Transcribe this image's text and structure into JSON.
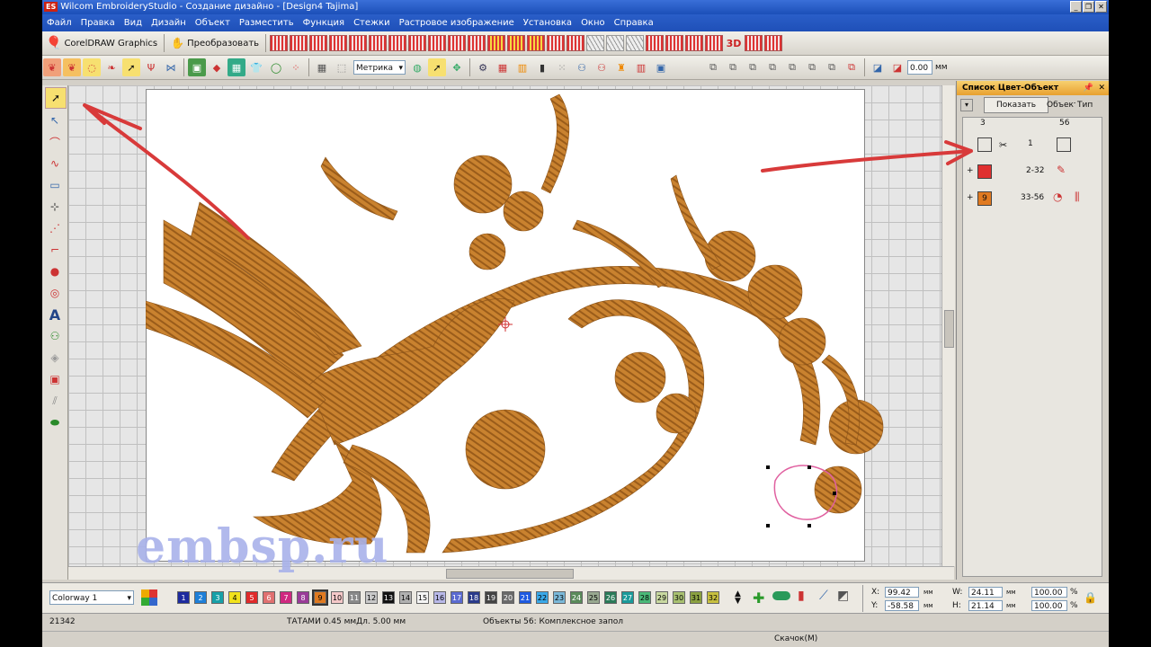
{
  "window": {
    "app_badge": "ES",
    "title": "Wilcom EmbroideryStudio - Создание дизайно - [Design4         Tajima]"
  },
  "menu": [
    "Файл",
    "Правка",
    "Вид",
    "Дизайн",
    "Объект",
    "Разместить",
    "Функция",
    "Стежки",
    "Растровое изображение",
    "Установка",
    "Окно",
    "Справка"
  ],
  "toolbar": {
    "coreldraw_label": "CorelDRAW Graphics",
    "transform_label": "Преобразовать",
    "units_select": "Метрика",
    "offset_value": "0.00",
    "offset_unit": "мм"
  },
  "panel": {
    "title": "Список Цвет-Объект",
    "show_button": "Показать",
    "col_object": "Объект",
    "col_type": "Тип",
    "count_left": "3",
    "count_right": "56",
    "rows": [
      {
        "label": "1",
        "color": "#222222"
      },
      {
        "label": "2-32",
        "color": "#e03030"
      },
      {
        "label": "33-56",
        "color": "#e07a20",
        "badge": "9"
      }
    ]
  },
  "colorway": {
    "name": "Colorway 1",
    "swatches": [
      {
        "n": "1",
        "c": "#1d2a9e",
        "t": "#fff"
      },
      {
        "n": "2",
        "c": "#1e7fd8",
        "t": "#fff"
      },
      {
        "n": "3",
        "c": "#17a0a8",
        "t": "#fff"
      },
      {
        "n": "4",
        "c": "#f2e21c",
        "t": "#000"
      },
      {
        "n": "5",
        "c": "#e02a2a",
        "t": "#fff"
      },
      {
        "n": "6",
        "c": "#e07070",
        "t": "#fff"
      },
      {
        "n": "7",
        "c": "#d02880",
        "t": "#fff"
      },
      {
        "n": "8",
        "c": "#9a3c98",
        "t": "#fff"
      },
      {
        "n": "9",
        "c": "#e07a20",
        "t": "#000"
      },
      {
        "n": "10",
        "c": "#f5c8c8",
        "t": "#000"
      },
      {
        "n": "11",
        "c": "#8a8a8a",
        "t": "#fff"
      },
      {
        "n": "12",
        "c": "#c8c8c8",
        "t": "#000"
      },
      {
        "n": "13",
        "c": "#111111",
        "t": "#fff"
      },
      {
        "n": "14",
        "c": "#b0b0b0",
        "t": "#000"
      },
      {
        "n": "15",
        "c": "#f4f4f4",
        "t": "#000"
      },
      {
        "n": "16",
        "c": "#b8b8e8",
        "t": "#000"
      },
      {
        "n": "17",
        "c": "#5a6ad0",
        "t": "#fff"
      },
      {
        "n": "18",
        "c": "#2a3a8a",
        "t": "#fff"
      },
      {
        "n": "19",
        "c": "#444444",
        "t": "#fff"
      },
      {
        "n": "20",
        "c": "#6a6a6a",
        "t": "#fff"
      },
      {
        "n": "21",
        "c": "#1e5ae0",
        "t": "#fff"
      },
      {
        "n": "22",
        "c": "#3aa8e8",
        "t": "#000"
      },
      {
        "n": "23",
        "c": "#7ab8d8",
        "t": "#000"
      },
      {
        "n": "24",
        "c": "#5a8a5a",
        "t": "#fff"
      },
      {
        "n": "25",
        "c": "#98a890",
        "t": "#000"
      },
      {
        "n": "26",
        "c": "#2a7a58",
        "t": "#fff"
      },
      {
        "n": "27",
        "c": "#1a9a9a",
        "t": "#fff"
      },
      {
        "n": "28",
        "c": "#4ab878",
        "t": "#000"
      },
      {
        "n": "29",
        "c": "#c8d8a0",
        "t": "#000"
      },
      {
        "n": "30",
        "c": "#a8c070",
        "t": "#000"
      },
      {
        "n": "31",
        "c": "#8aa040",
        "t": "#000"
      },
      {
        "n": "32",
        "c": "#c8c040",
        "t": "#000"
      }
    ]
  },
  "coords": {
    "x_label": "X:",
    "x_value": "99.42",
    "y_label": "Y:",
    "y_value": "-58.58",
    "w_label": "W:",
    "w_value": "24.11",
    "h_label": "H:",
    "h_value": "21.14",
    "unit": "мм",
    "scale_w": "100.00",
    "scale_h": "100.00",
    "pct": "%"
  },
  "status": {
    "stitch_count": "21342",
    "stitch_info": "ТАТАМИ  0.45 ммДл.  5.00 мм",
    "object_info": "Объекты 56: Комплексное запол",
    "bottom_text": "Скачок(М)"
  },
  "watermark": "embsp.ru",
  "accent": "#e07a20"
}
